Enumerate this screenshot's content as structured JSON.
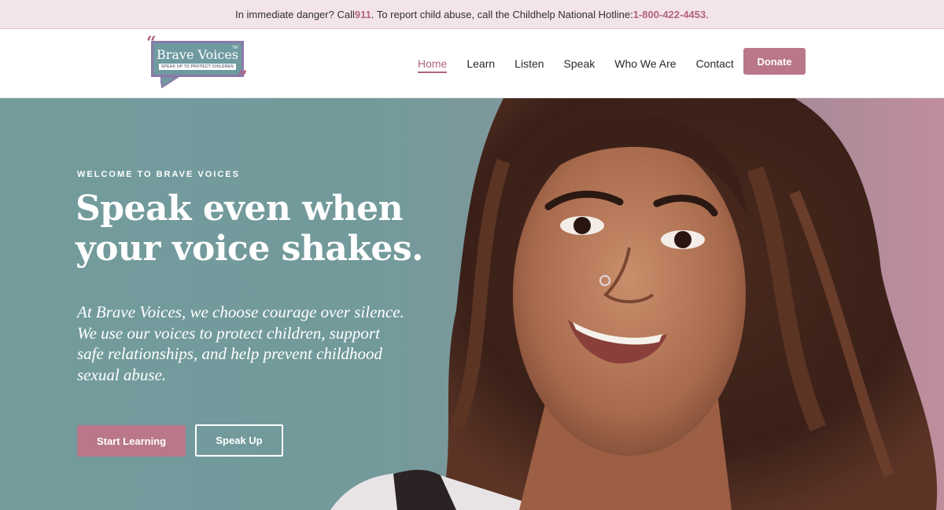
{
  "alert": {
    "text_before": "In immediate danger? Call ",
    "emergency_number": "911",
    "text_middle": ". To report child abuse, call the Childhelp National Hotline: ",
    "hotline_number": "1-800-422-4453",
    "text_after": "."
  },
  "logo": {
    "title": "Brave Voices",
    "trademark": "TM",
    "tagline": "SPEAK UP TO PROTECT CHILDREN",
    "open_quote": "“",
    "close_quote": "”"
  },
  "nav": {
    "items": [
      {
        "label": "Home",
        "active": true
      },
      {
        "label": "Learn",
        "active": false
      },
      {
        "label": "Listen",
        "active": false
      },
      {
        "label": "Speak",
        "active": false
      },
      {
        "label": "Who We Are",
        "active": false
      },
      {
        "label": "Contact",
        "active": false
      }
    ],
    "donate_label": "Donate"
  },
  "hero": {
    "eyebrow": "WELCOME TO BRAVE VOICES",
    "title": "Speak even when your voice shakes.",
    "body": "At Brave Voices, we choose courage over silence. We use our voices to protect children, support safe relationships, and help prevent childhood sexual abuse.",
    "primary_cta": "Start Learning",
    "secondary_cta": "Speak Up",
    "image_description_icon": "smiling-woman-portrait"
  },
  "colors": {
    "accent": "#b97789",
    "alert_bg": "#f3e4e8",
    "hero_teal": "#739b9c",
    "logo_teal": "#6e9aa0"
  }
}
